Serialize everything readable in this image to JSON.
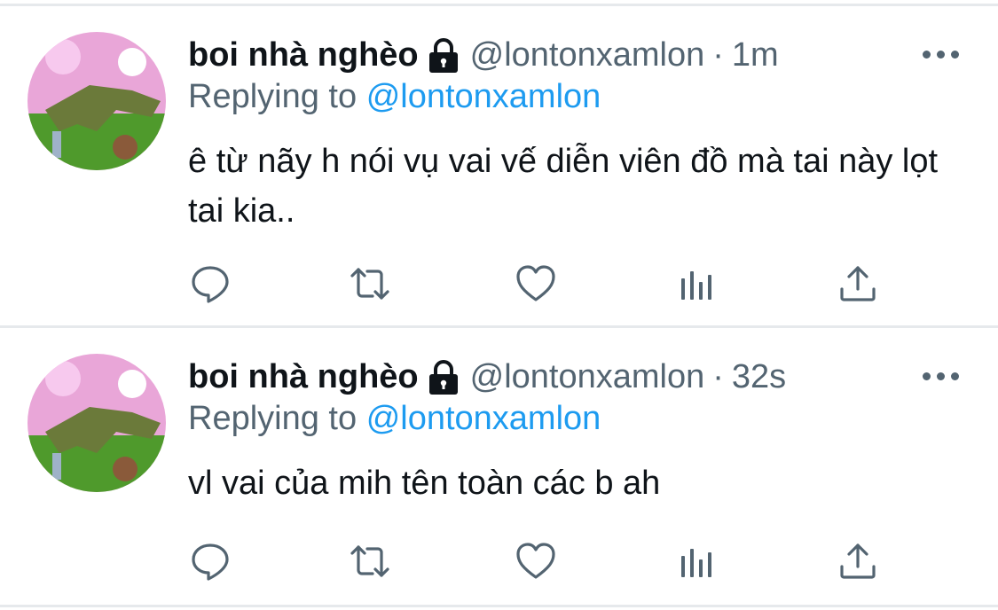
{
  "tweets": [
    {
      "display_name": "boi nhà nghèo",
      "handle": "@lontonxamlon",
      "separator": "·",
      "time": "1m",
      "replying_prefix": "Replying to",
      "replying_to": "@lontonxamlon",
      "text": "ê từ nãy h nói vụ vai vế diễn viên đồ mà tai này lọt tai kia.."
    },
    {
      "display_name": "boi nhà nghèo",
      "handle": "@lontonxamlon",
      "separator": "·",
      "time": "32s",
      "replying_prefix": "Replying to",
      "replying_to": "@lontonxamlon",
      "text": "vl vai của mih tên toàn các b ah"
    }
  ],
  "icons": {
    "lock": "lock-icon",
    "more": "more-icon",
    "actions": [
      "reply-icon",
      "retweet-icon",
      "like-icon",
      "analytics-icon",
      "share-icon"
    ]
  },
  "colors": {
    "text_primary": "#0f1419",
    "text_secondary": "#536471",
    "link": "#1d9bf0",
    "divider": "#e6e9ec",
    "avatar_background": "#e9a6d8",
    "avatar_grass": "#4f9a2c"
  }
}
